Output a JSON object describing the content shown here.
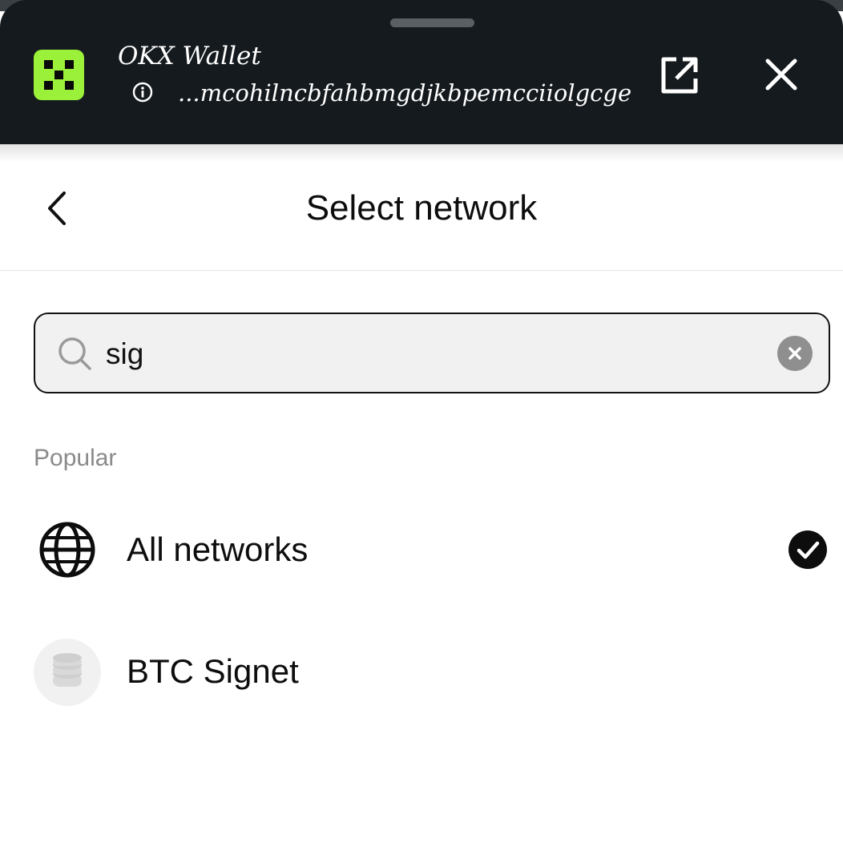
{
  "header": {
    "app_title": "OKX Wallet",
    "app_url": "...mcohilncbfahbmgdjkbpemcciiolgcge",
    "logo_color": "#9bf03a",
    "icons": [
      "info-icon",
      "open-external-icon",
      "close-icon"
    ]
  },
  "nav": {
    "title": "Select network",
    "back_icon": "chevron-left-icon"
  },
  "search": {
    "value": "sig",
    "icons": [
      "search-icon",
      "clear-icon"
    ]
  },
  "section": {
    "label": "Popular"
  },
  "networks": [
    {
      "label": "All networks",
      "icon": "globe-icon",
      "selected": true
    },
    {
      "label": "BTC Signet",
      "icon": "coin-stack-icon",
      "selected": false
    }
  ]
}
